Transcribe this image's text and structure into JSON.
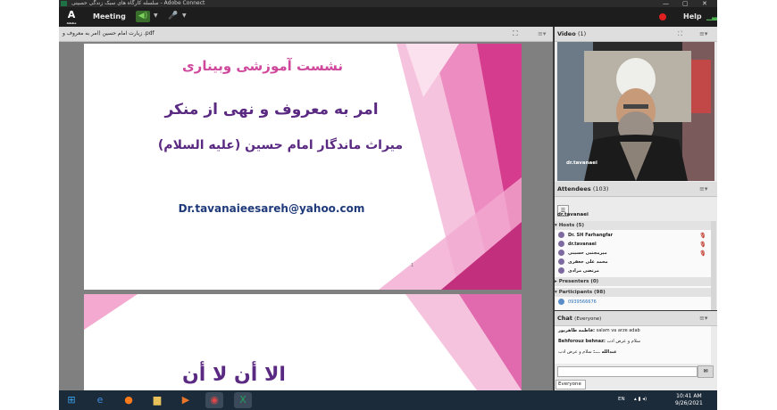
{
  "window": {
    "title": "سلسله کارگاه های سبک زندگی حسینی - Adobe Connect"
  },
  "menubar": {
    "logo": "A",
    "logo_sub": "Adobe",
    "meeting_label": "Meeting",
    "help_label": "Help"
  },
  "share_pod": {
    "file_name": "زیارت امام حسین‌ (امر به معروف و .pdf",
    "slide1": {
      "title": "نشست آموزشی وبیناری",
      "line1": "امر به معروف و نهی از منکر",
      "line2": "میراث ماندگار امام حسین (علیه السلام)",
      "email": "Dr.tavanaieesareh@yahoo.com",
      "page_number": "1"
    },
    "slide2": {
      "partial_text": "الا أن لا أن"
    }
  },
  "video_pod": {
    "title": "Video",
    "count": "(1)",
    "speaker_name": "dr.tavanaei"
  },
  "attendees_pod": {
    "title": "Attendees",
    "count": "(103)",
    "me": "dr.tavanaei",
    "hosts_header": "Hosts (5)",
    "hosts": [
      "Dr. SH Farhangfar",
      "dr.tavanaei",
      "میرمجتبی حسینی",
      "محمد علی جعفری",
      "مرتضی مرادی"
    ],
    "presenters_header": "Presenters (0)",
    "participants_header": "Participants (98)",
    "participants": [
      "0939566676"
    ]
  },
  "chat_pod": {
    "title": "Chat",
    "scope": "(Everyone)",
    "messages": [
      {
        "sender": "فاطمه طاهرپور:",
        "text": "salam va arze adab"
      },
      {
        "sender": "Behforouz behnaz:",
        "text": "سلام و عرض ادب"
      },
      {
        "sender": "عبدالله ...:",
        "text": "سلام و عرض ادب"
      }
    ],
    "send_label": "✉",
    "recipient": "Everyone"
  },
  "taskbar": {
    "language": "EN",
    "time": "10:41 AM",
    "date": "9/26/2021"
  },
  "colors": {
    "slide_pink": "#d0489c",
    "slide_purple": "#5a2a82",
    "email_blue": "#1f3a7a",
    "mic_active": "#c0392b"
  }
}
